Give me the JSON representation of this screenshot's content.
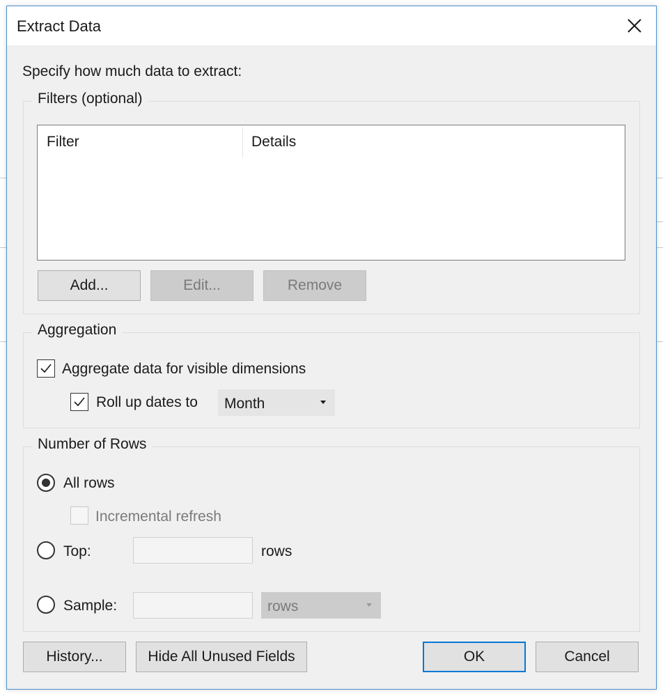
{
  "dialog": {
    "title": "Extract Data",
    "prompt": "Specify how much data to extract:"
  },
  "filters": {
    "group_label": "Filters (optional)",
    "columns": [
      "Filter",
      "Details"
    ],
    "add_label": "Add...",
    "edit_label": "Edit...",
    "remove_label": "Remove"
  },
  "aggregation": {
    "group_label": "Aggregation",
    "aggregate_label": "Aggregate data for visible dimensions",
    "aggregate_checked": true,
    "rollup_label": "Roll up dates to",
    "rollup_checked": true,
    "rollup_value": "Month"
  },
  "rows": {
    "group_label": "Number of Rows",
    "all_rows_label": "All rows",
    "incremental_label": "Incremental refresh",
    "top_label": "Top:",
    "top_value": "",
    "top_unit": "rows",
    "sample_label": "Sample:",
    "sample_value": "",
    "sample_unit": "rows",
    "selected": "all"
  },
  "footer": {
    "history_label": "History...",
    "hide_unused_label": "Hide All Unused Fields",
    "ok_label": "OK",
    "cancel_label": "Cancel"
  },
  "icons": {
    "close": "close-icon",
    "check": "checkmark-icon",
    "dropdown": "dropdown-arrow-icon"
  },
  "colors": {
    "accent": "#0078d7",
    "dialog_bg": "#f0f0f0",
    "disabled_text": "#7a7a7a"
  }
}
